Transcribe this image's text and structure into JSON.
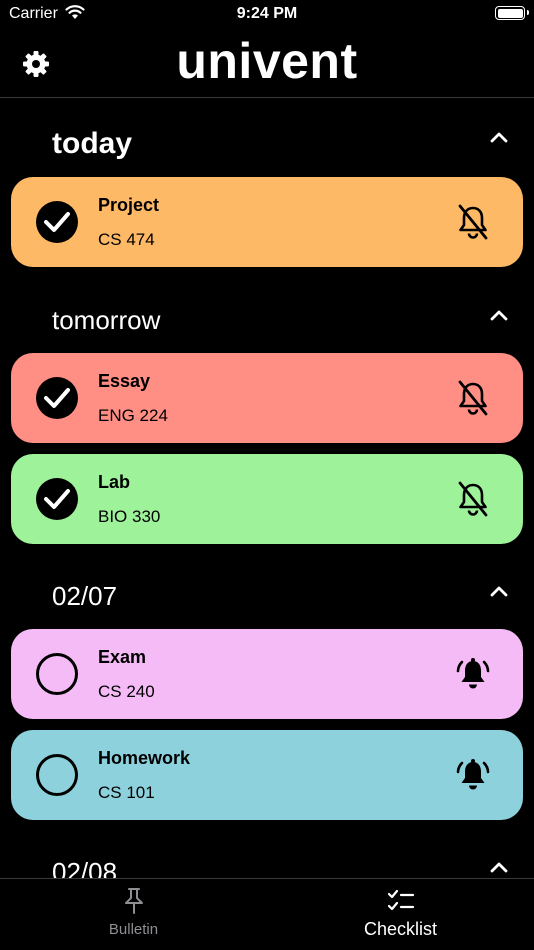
{
  "status_bar": {
    "carrier": "Carrier",
    "time": "9:24 PM"
  },
  "header": {
    "title": "univent"
  },
  "sections": [
    {
      "label": "today",
      "items": [
        {
          "name": "Project",
          "course": "CS 474",
          "color": "#FDB966",
          "done": true,
          "reminder": false
        }
      ]
    },
    {
      "label": "tomorrow",
      "items": [
        {
          "name": "Essay",
          "course": "ENG 224",
          "color": "#FF8E85",
          "done": true,
          "reminder": false
        },
        {
          "name": "Lab",
          "course": "BIO 330",
          "color": "#9EF29A",
          "done": true,
          "reminder": false
        }
      ]
    },
    {
      "label": "02/07",
      "items": [
        {
          "name": "Exam",
          "course": "CS 240",
          "color": "#F4BBF6",
          "done": false,
          "reminder": true
        },
        {
          "name": "Homework",
          "course": "CS 101",
          "color": "#8DD1DD",
          "done": false,
          "reminder": true
        }
      ]
    },
    {
      "label": "02/08",
      "items": []
    }
  ],
  "tabs": [
    {
      "label": "Bulletin",
      "icon": "pin-icon",
      "active": false
    },
    {
      "label": "Checklist",
      "icon": "checklist-icon",
      "active": true
    }
  ]
}
